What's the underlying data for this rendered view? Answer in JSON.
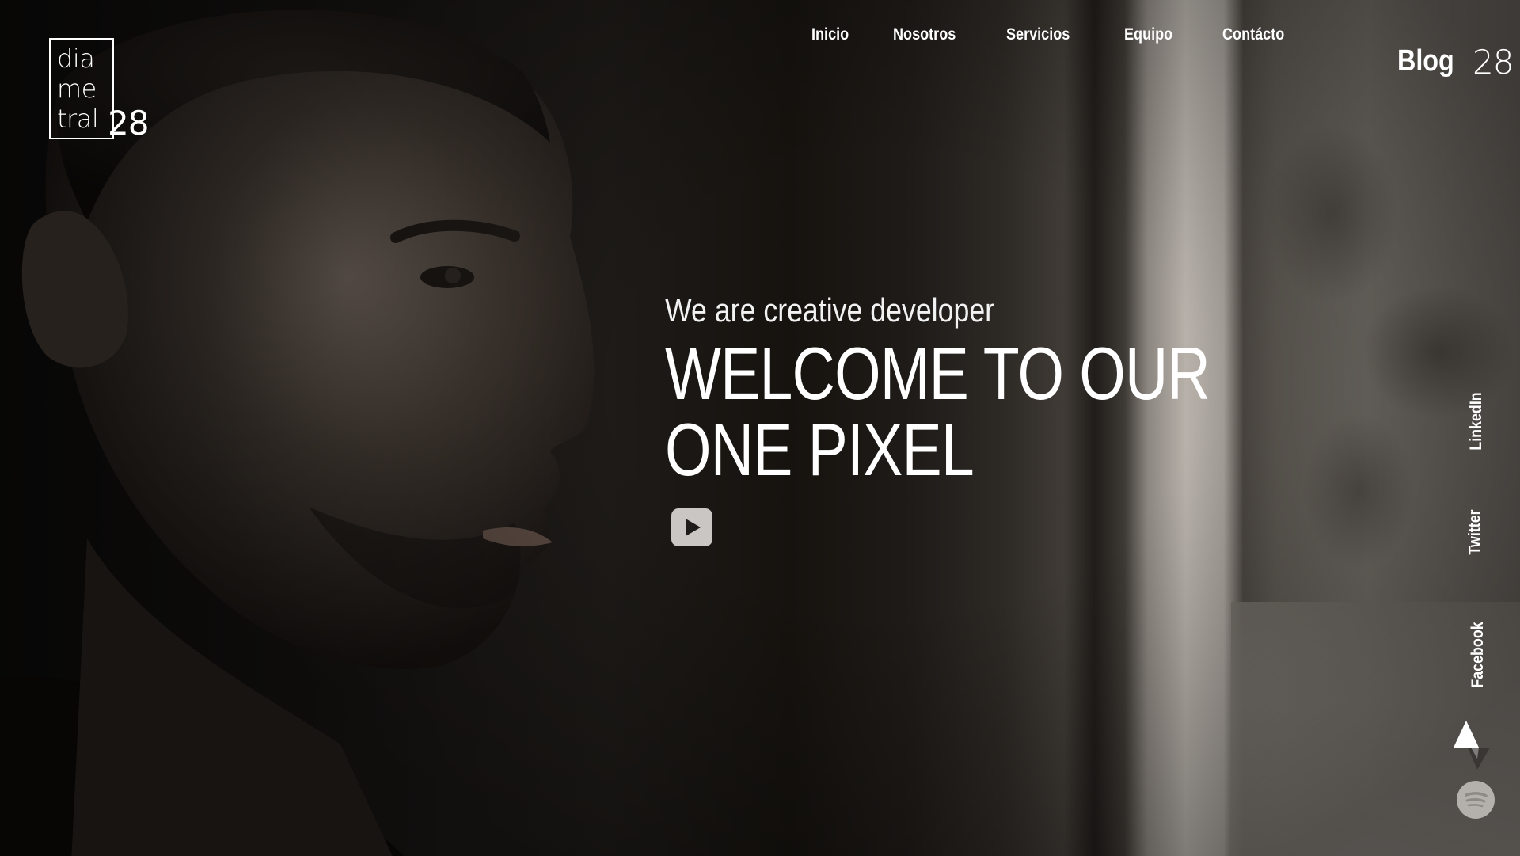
{
  "logo": {
    "line1": "dia",
    "line2": "me",
    "line3": "tral",
    "number": "28"
  },
  "nav": {
    "items": [
      {
        "label": "Inicio"
      },
      {
        "label": "Nosotros"
      },
      {
        "label": "Servicios"
      },
      {
        "label": "Equipo"
      },
      {
        "label": "Contácto"
      }
    ]
  },
  "blog": {
    "word": "Blog",
    "number": "28"
  },
  "hero": {
    "subtitle": "We are creative developer",
    "title_line1": "WELCOME TO OUR",
    "title_line2": "ONE PIXEL",
    "play_icon": "play-icon"
  },
  "social": {
    "linkedin": "LinkedIn",
    "twitter": "Twitter",
    "facebook": "Facebook",
    "brand_icon": "triangle-arrow-logo-icon",
    "spotify_icon": "spotify-icon"
  },
  "colors": {
    "text": "#ffffff",
    "play_button_bg": "#c9c6c3",
    "play_triangle": "#1e1c1a",
    "spotify_bg": "#b4b0ab"
  }
}
